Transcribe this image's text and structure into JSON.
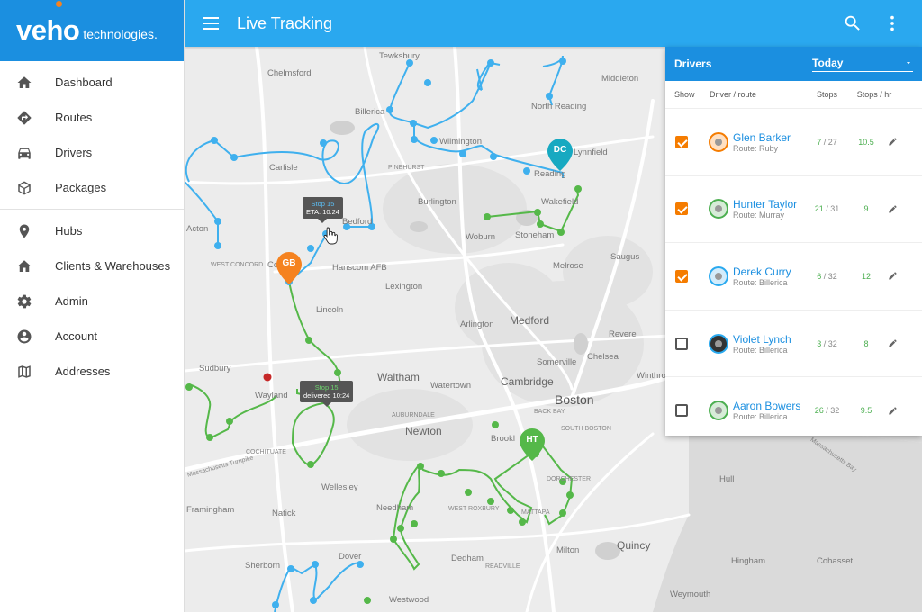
{
  "logo": {
    "brand": "veho",
    "sub": "technologies."
  },
  "header": {
    "title": "Live Tracking"
  },
  "sidebar": {
    "items": [
      {
        "label": "Dashboard",
        "icon": "home-icon"
      },
      {
        "label": "Routes",
        "icon": "directions-icon"
      },
      {
        "label": "Drivers",
        "icon": "car-icon"
      },
      {
        "label": "Packages",
        "icon": "package-icon"
      },
      {
        "label": "Hubs",
        "icon": "location-pin-icon"
      },
      {
        "label": "Clients & Warehouses",
        "icon": "home-icon"
      },
      {
        "label": "Admin",
        "icon": "gear-icon"
      },
      {
        "label": "Account",
        "icon": "account-icon"
      },
      {
        "label": "Addresses",
        "icon": "map-icon"
      }
    ]
  },
  "panel": {
    "title": "Drivers",
    "range": "Today",
    "columns": {
      "show": "Show",
      "driver": "Driver / route",
      "stops": "Stops",
      "rate": "Stops / hr"
    },
    "drivers": [
      {
        "name": "Glen Barker",
        "route": "Route: Ruby",
        "done": "7",
        "total": " / 27",
        "rate": "10.5",
        "checked": true
      },
      {
        "name": "Hunter Taylor",
        "route": "Route: Murray",
        "done": "21",
        "total": " / 31",
        "rate": "9",
        "checked": true
      },
      {
        "name": "Derek Curry",
        "route": "Route: Billerica",
        "done": "6",
        "total": " / 32",
        "rate": "12",
        "checked": true
      },
      {
        "name": "Violet Lynch",
        "route": "Route: Billerica",
        "done": "3",
        "total": " / 32",
        "rate": "8",
        "checked": false
      },
      {
        "name": "Aaron Bowers",
        "route": "Route: Billerica",
        "done": "26",
        "total": " / 32",
        "rate": "9.5",
        "checked": false
      }
    ]
  },
  "map": {
    "places": {
      "tewksbury": "Tewksbury",
      "middleton": "Middleton",
      "chelmsford": "Chelmsford",
      "north_reading": "North Reading",
      "billerica": "Billerica",
      "wilmington": "Wilmington",
      "lynnfield": "Lynnfield",
      "carlisle": "Carlisle",
      "pinehurst": "PINEHURST",
      "reading": "Reading",
      "burlington": "Burlington",
      "wakefield": "Wakefield",
      "acton": "Acton",
      "bedford": "Bedford",
      "woburn": "Woburn",
      "stoneham": "Stoneham",
      "saugus": "Saugus",
      "west_concord": "WEST CONCORD",
      "concord": "Co",
      "hanscom": "Hanscom AFB",
      "melrose": "Melrose",
      "lexington": "Lexington",
      "lincoln": "Lincoln",
      "medford": "Medford",
      "revere": "Revere",
      "arlington": "Arlington",
      "sudbury": "Sudbury",
      "somerville": "Somerville",
      "chelsea": "Chelsea",
      "waltham": "Waltham",
      "winthrop": "Winthrop",
      "wayland": "Wayland",
      "watertown": "Watertown",
      "cambridge": "Cambridge",
      "boston": "Boston",
      "auburndale": "AUBURNDALE",
      "back_bay": "BACK BAY",
      "newton": "Newton",
      "south_boston": "SOUTH BOSTON",
      "brookline": "Brookl",
      "cochituate": "COCHITUATE",
      "mass_pike": "Massachusetts Turnpike",
      "massachusetts_bay": "Massachusetts Bay",
      "dorchester": "DORCHESTER",
      "hull": "Hull",
      "wellesley": "Wellesley",
      "framingham": "Framingham",
      "natick": "Natick",
      "needham": "Needham",
      "west_roxbury": "WEST ROXBURY",
      "mattapan": "MATTAPA",
      "milton": "Milton",
      "quincy": "Quincy",
      "dover": "Dover",
      "dedham": "Dedham",
      "hingham": "Hingham",
      "cohasset": "Cohasset",
      "sherborn": "Sherborn",
      "readville": "READVILLE",
      "weymouth": "Weymouth",
      "westwood": "Westwood"
    },
    "pins": {
      "dc": "DC",
      "gb": "GB",
      "ht": "HT"
    },
    "tooltips": {
      "blue": {
        "line1": "Stop 15",
        "line2": "ETA: 10:24"
      },
      "green": {
        "line1": "Stop 15",
        "line2": "delivered 10:24"
      }
    }
  },
  "colors": {
    "accent": "#1b8fe0",
    "topbar": "#2aa8ef",
    "route_blue": "#3fb0ee",
    "route_green": "#55b849",
    "pin_orange": "#f5821f",
    "pin_teal": "#17a9c1",
    "checkbox": "#f57c00"
  }
}
